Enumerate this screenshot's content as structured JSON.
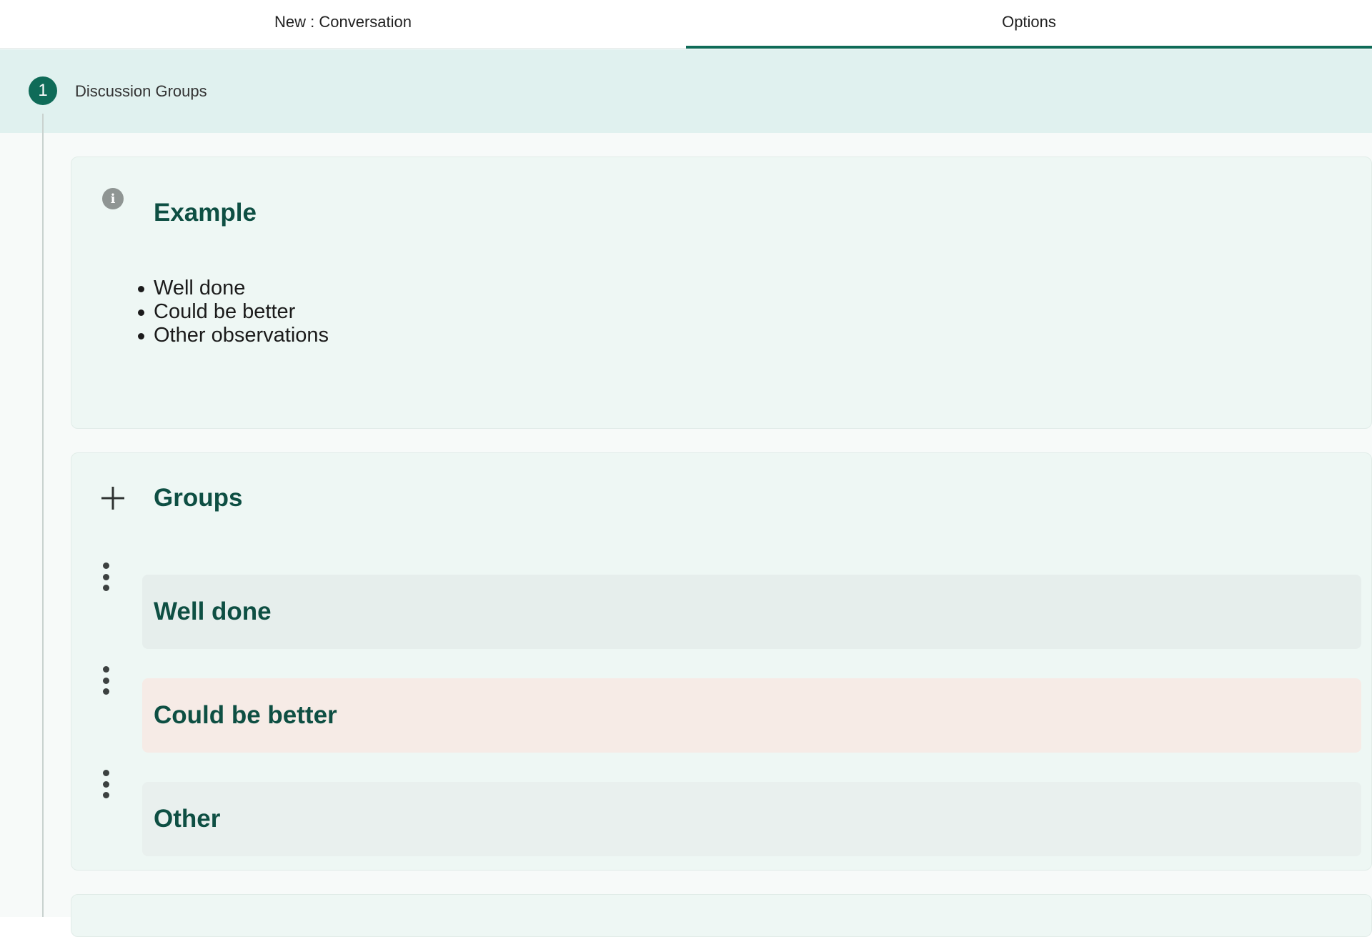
{
  "tabs": [
    {
      "label": "New : Conversation",
      "active": false
    },
    {
      "label": "Options",
      "active": true
    }
  ],
  "step": {
    "number": "1",
    "title": "Discussion Groups"
  },
  "example": {
    "icon": "info-icon",
    "title": "Example",
    "items": [
      "Well done",
      "Could be better",
      "Other observations"
    ]
  },
  "groups": {
    "icon": "plus-icon",
    "title": "Groups",
    "items": [
      {
        "label": "Well done",
        "color": "#e6eeec"
      },
      {
        "label": "Could be better",
        "color": "#f6ebe6"
      },
      {
        "label": "Other",
        "color": "#e9f0ee"
      }
    ]
  },
  "colors": {
    "accent": "#0f6b58",
    "heading": "#0e4f43",
    "step_header_bg": "#e0f1ef",
    "card_bg": "#eef7f4"
  }
}
